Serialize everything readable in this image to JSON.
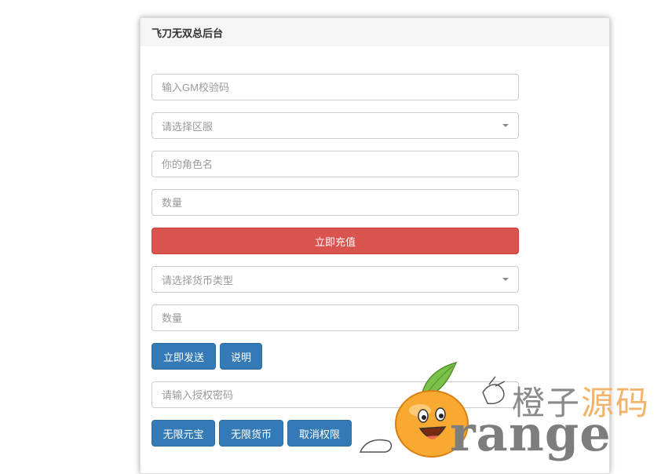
{
  "panel": {
    "title": "飞刀无双总后台"
  },
  "form": {
    "gm_code_placeholder": "输入GM校验码",
    "server_select_text": "请选择区服",
    "role_name_placeholder": "你的角色名",
    "quantity_placeholder": "数量",
    "recharge_button": "立即充值",
    "currency_select_text": "请选择货币类型",
    "currency_quantity_placeholder": "数量",
    "send_button": "立即发送",
    "help_button": "说明",
    "auth_password_placeholder": "请输入授权密码",
    "unlimited_yuanbao_button": "无限元宝",
    "unlimited_currency_button": "无限货币",
    "revoke_permission_button": "取消权限"
  },
  "watermark": {
    "cn_dark": "橙子",
    "cn_light": "源码",
    "en": "range",
    "logo": "orange-mascot-logo"
  },
  "colors": {
    "danger": "#d9534f",
    "primary": "#337ab7",
    "header_bg": "#f5f5f5"
  }
}
